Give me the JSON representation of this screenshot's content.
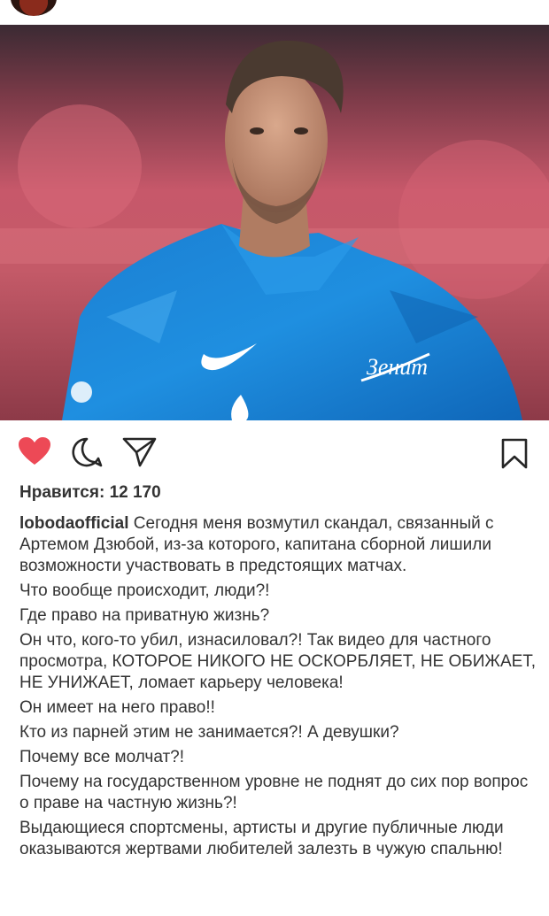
{
  "post": {
    "likes_text": "Нравится: 12 170",
    "username": "lobodaofficial",
    "paragraphs": [
      "Сегодня меня возмутил скандал, связанный  с Артемом Дзюбой, из-за которого, капитана сборной лишили возможности участвовать в предстоящих матчах.",
      "Что вообще происходит, люди?!",
      "Где право на приватную жизнь?",
      "Он что, кого-то убил, изнасиловал?! Так видео для частного просмотра, КОТОРОЕ НИКОГО НЕ ОСКОРБЛЯЕТ, НЕ ОБИЖАЕТ, НЕ УНИЖАЕТ, ломает карьеру человека!",
      "Он имеет на него право!!",
      "Кто из парней этим не занимается?! А девушки?",
      "Почему все молчат?!",
      "Почему  на государственном уровне не поднят до сих пор вопрос о праве на частную жизнь?!",
      "Выдающиеся спортсмены, артисты и другие публичные люди оказываются жертвами любителей залезть в чужую спальню!"
    ]
  },
  "jersey": {
    "club_logo_text": "Зенит"
  },
  "colors": {
    "like_active": "#ed4956",
    "jersey_blue": "#1f86d6"
  },
  "icons": {
    "like": "heart-icon",
    "comment": "comment-icon",
    "share": "send-icon",
    "save": "bookmark-icon"
  }
}
